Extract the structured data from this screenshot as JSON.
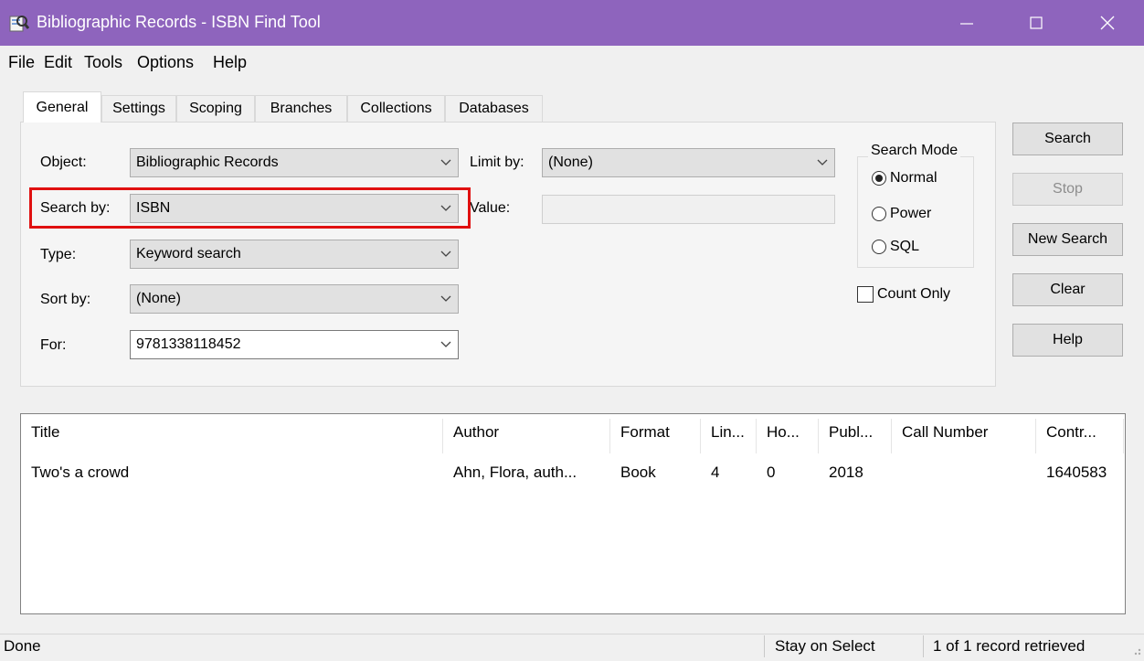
{
  "window": {
    "title": "Bibliographic Records - ISBN Find Tool",
    "titlebar_color": "#8e64bd"
  },
  "menu": [
    "File",
    "Edit",
    "Tools",
    "Options",
    "Help"
  ],
  "tabs": [
    "General",
    "Settings",
    "Scoping",
    "Branches",
    "Collections",
    "Databases"
  ],
  "active_tab": "General",
  "form": {
    "object_label": "Object:",
    "object_value": "Bibliographic Records",
    "search_by_label": "Search by:",
    "search_by_value": "ISBN",
    "type_label": "Type:",
    "type_value": "Keyword search",
    "sort_by_label": "Sort by:",
    "sort_by_value": "(None)",
    "for_label": "For:",
    "for_value": "9781338118452",
    "limit_by_label": "Limit by:",
    "limit_by_value": "(None)",
    "value_label": "Value:",
    "value_value": ""
  },
  "search_mode": {
    "legend": "Search Mode",
    "options": [
      "Normal",
      "Power",
      "SQL"
    ],
    "selected": "Normal"
  },
  "count_only": {
    "label": "Count Only",
    "checked": false
  },
  "buttons": {
    "search": "Search",
    "stop": "Stop",
    "new_search": "New Search",
    "clear": "Clear",
    "help": "Help"
  },
  "results": {
    "columns": [
      "Title",
      "Author",
      "Format",
      "Lin...",
      "Ho...",
      "Publ...",
      "Call Number",
      "Contr..."
    ],
    "rows": [
      [
        "Two's a crowd",
        "Ahn, Flora, auth...",
        "Book",
        "4",
        "0",
        "2018",
        "",
        "1640583"
      ]
    ]
  },
  "status": {
    "left": "Done",
    "mode": "Stay on Select",
    "count": "1 of 1 record retrieved"
  },
  "highlight_color": "#e01010"
}
